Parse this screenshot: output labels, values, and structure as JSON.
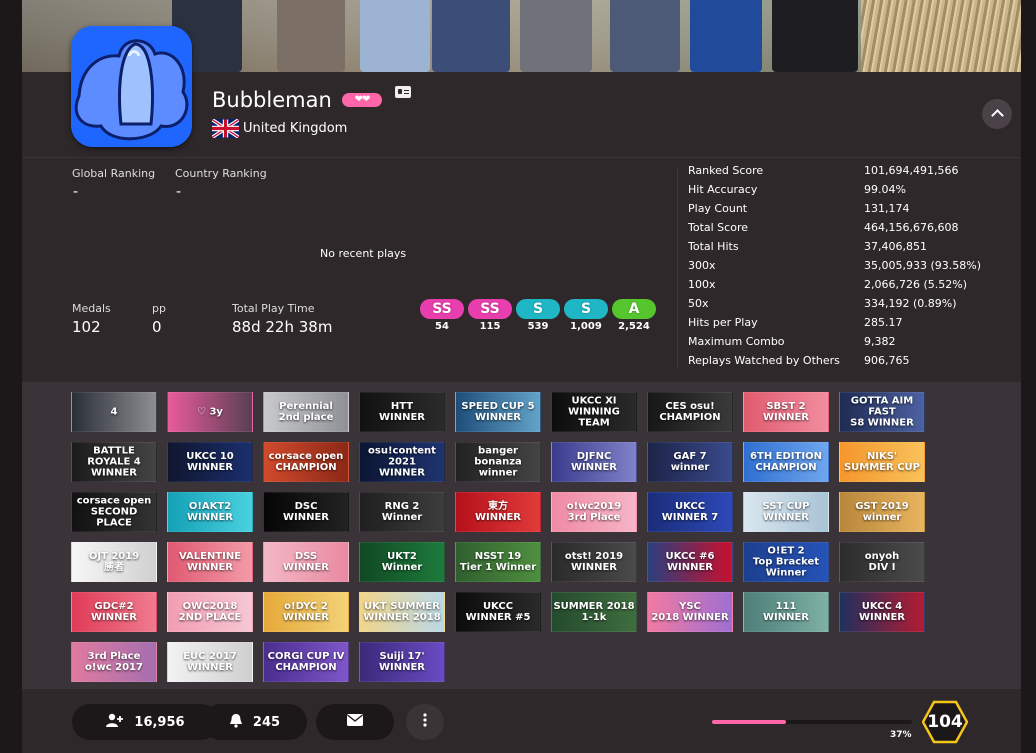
{
  "profile": {
    "username": "Bubbleman",
    "supporter_hearts": "❤❤",
    "country": "United Kingdom"
  },
  "ranking": {
    "global_label": "Global Ranking",
    "global_value": "-",
    "country_label": "Country Ranking",
    "country_value": "-"
  },
  "recent": {
    "empty_text": "No recent plays"
  },
  "summary": {
    "medals_label": "Medals",
    "medals_value": "102",
    "pp_label": "pp",
    "pp_value": "0",
    "playtime_label": "Total Play Time",
    "playtime_value": "88d 22h 38m"
  },
  "grades": [
    {
      "grade": "SS",
      "count": "54",
      "color": "#e93fae"
    },
    {
      "grade": "SS",
      "count": "115",
      "color": "#e93fae"
    },
    {
      "grade": "S",
      "count": "539",
      "color": "#1fb6c6"
    },
    {
      "grade": "S",
      "count": "1,009",
      "color": "#1fb6c6"
    },
    {
      "grade": "A",
      "count": "2,524",
      "color": "#55c62e"
    }
  ],
  "stats": [
    {
      "label": "Ranked Score",
      "value": "101,694,491,566"
    },
    {
      "label": "Hit Accuracy",
      "value": "99.04%"
    },
    {
      "label": "Play Count",
      "value": "131,174"
    },
    {
      "label": "Total Score",
      "value": "464,156,676,608"
    },
    {
      "label": "Total Hits",
      "value": "37,406,851"
    },
    {
      "label": "300x",
      "value": "35,005,933 (93.58%)"
    },
    {
      "label": "100x",
      "value": "2,066,726 (5.52%)"
    },
    {
      "label": "50x",
      "value": "334,192 (0.89%)"
    },
    {
      "label": "Hits per Play",
      "value": "285.17"
    },
    {
      "label": "Maximum Combo",
      "value": "9,382"
    },
    {
      "label": "Replays Watched by Others",
      "value": "906,765"
    }
  ],
  "badges": [
    {
      "text": "4",
      "bg": "linear-gradient(90deg,#2a2f37,#8d8e93)"
    },
    {
      "text": "♡  3y",
      "bg": "linear-gradient(90deg,#e85b9c,#5a3f53)"
    },
    {
      "text": "Perennial\n2nd place",
      "bg": "linear-gradient(90deg,#c8c9cc,#8f9196)"
    },
    {
      "text": "HTT\nWINNER",
      "bg": "linear-gradient(90deg,#111,#2b2b2b)"
    },
    {
      "text": "SPEED CUP 5\nWINNER",
      "bg": "linear-gradient(90deg,#1d4e7a,#63a3c9)"
    },
    {
      "text": "UKCC XI\nWINNING TEAM",
      "bg": "linear-gradient(90deg,#0d0d0d,#2a2a2a)"
    },
    {
      "text": "CES osu!\nCHAMPION",
      "bg": "linear-gradient(90deg,#171717,#3a3a3a)"
    },
    {
      "text": "SBST 2\nWINNER",
      "bg": "linear-gradient(90deg,#e05b6f,#f28ca0)"
    },
    {
      "text": "GOTTA AIM FAST\nS8 WINNER",
      "bg": "linear-gradient(90deg,#1e2b52,#4d62a3)"
    },
    {
      "text": "BATTLE ROYALE 4\nWINNER",
      "bg": "linear-gradient(90deg,#1b1b1b,#444)"
    },
    {
      "text": "UKCC 10\nWINNER",
      "bg": "linear-gradient(90deg,#10162f,#1b2f6e)"
    },
    {
      "text": "corsace open\nCHAMPION",
      "bg": "linear-gradient(90deg,#d14a2c,#8c2817)"
    },
    {
      "text": "osu!content 2021\nWINNER",
      "bg": "linear-gradient(90deg,#0b1533,#1f3470)"
    },
    {
      "text": "banger\nbonanza winner",
      "bg": "linear-gradient(90deg,#222,#444)"
    },
    {
      "text": "DJFNC\nWINNER",
      "bg": "linear-gradient(90deg,#3b3c8e,#7f82c8)"
    },
    {
      "text": "GAF 7\nwinner",
      "bg": "linear-gradient(90deg,#1c2448,#3a4a8c)"
    },
    {
      "text": "6TH EDITION\nCHAMPION",
      "bg": "linear-gradient(90deg,#2f6fd1,#6fa6ee)"
    },
    {
      "text": "NIKS'\nSUMMER CUP",
      "bg": "linear-gradient(90deg,#f5962c,#f8c25a)"
    },
    {
      "text": "corsace open\nSECOND PLACE",
      "bg": "linear-gradient(90deg,#111,#333)"
    },
    {
      "text": "O!AKT2\nWINNER",
      "bg": "linear-gradient(90deg,#14a1b6,#49d1e0)"
    },
    {
      "text": "DSC\nWINNER",
      "bg": "linear-gradient(90deg,#050505,#222)"
    },
    {
      "text": "RNG 2\nWinner",
      "bg": "linear-gradient(90deg,#1f1f1f,#3d3d3d)"
    },
    {
      "text": "東方\nWINNER",
      "bg": "linear-gradient(90deg,#b5111b,#e13a3a)"
    },
    {
      "text": "o!wc2019\n3rd Place",
      "bg": "linear-gradient(90deg,#f08aa6,#f6b5c6)"
    },
    {
      "text": "UKCC\nWINNER 7",
      "bg": "linear-gradient(90deg,#1a2d7a,#2d49b8)"
    },
    {
      "text": "SST CUP\nWINNER",
      "bg": "linear-gradient(90deg,#d9e6ee,#a9c4d6)"
    },
    {
      "text": "GST 2019\nwinner",
      "bg": "linear-gradient(90deg,#b9873b,#e8b45e)"
    },
    {
      "text": "OJT 2019\n勝者",
      "bg": "linear-gradient(90deg,#f7f7f7,#d0d0d0)"
    },
    {
      "text": "VALENTINE\nWINNER",
      "bg": "linear-gradient(90deg,#e05a71,#f39aa8)"
    },
    {
      "text": "DSS\nWINNER",
      "bg": "linear-gradient(90deg,#f3b7c5,#e98aa2)"
    },
    {
      "text": "UKT2\nWinner",
      "bg": "linear-gradient(90deg,#0f4a23,#1e7a3c)"
    },
    {
      "text": "NSST 19\nTier 1 Winner",
      "bg": "linear-gradient(90deg,#2f5f2f,#4f8f3f)"
    },
    {
      "text": "otst! 2019\nWINNER",
      "bg": "linear-gradient(90deg,#2a2a2a,#4a4a4a)"
    },
    {
      "text": "UKCC #6\nWINNER",
      "bg": "linear-gradient(90deg,#2b3f7d,#c8102e)"
    },
    {
      "text": "O!ET 2\nTop Bracket Winner",
      "bg": "linear-gradient(90deg,#1d3f8f,#2653b8)"
    },
    {
      "text": "onyoh\nDIV I",
      "bg": "linear-gradient(90deg,#2c2c2c,#4b4b4b)"
    },
    {
      "text": "GDC#2\nWINNER",
      "bg": "linear-gradient(90deg,#e03c57,#f07b8e)"
    },
    {
      "text": "OWC2018\n2ND PLACE",
      "bg": "linear-gradient(90deg,#f19db2,#f7c7d3)"
    },
    {
      "text": "o!DYC 2\nWINNER",
      "bg": "linear-gradient(90deg,#e6a93a,#f2d278)"
    },
    {
      "text": "UKT SUMMER\nWINNER 2018",
      "bg": "linear-gradient(90deg,#f1d58a,#b9d8e8)"
    },
    {
      "text": "UKCC\nWINNER #5",
      "bg": "linear-gradient(90deg,#0c0c0c,#2a2a2a)"
    },
    {
      "text": "SUMMER 2018\n1-1k",
      "bg": "linear-gradient(90deg,#244b2d,#3f6d3f)"
    },
    {
      "text": "YSC\n2018 WINNER",
      "bg": "linear-gradient(90deg,#f27aa2,#9e6fd2)"
    },
    {
      "text": "111\nWINNER",
      "bg": "linear-gradient(90deg,#4e7f78,#7fb0a6)"
    },
    {
      "text": "UKCC 4\nWINNER",
      "bg": "linear-gradient(90deg,#20305f,#b31c33)"
    },
    {
      "text": "3rd Place\no!wc 2017",
      "bg": "linear-gradient(90deg,#e07aa0,#a56fae)"
    },
    {
      "text": "EUC 2017\nWINNER",
      "bg": "linear-gradient(90deg,#f2f2f2,#cfcfcf)"
    },
    {
      "text": "CORGI CUP IV\nCHAMPION",
      "bg": "linear-gradient(90deg,#4b2e8f,#7e56c9)"
    },
    {
      "text": "Suiji 17'\nWINNER",
      "bg": "linear-gradient(90deg,#3b2a7a,#6a4bc4)"
    }
  ],
  "footer": {
    "followers": "16,956",
    "mapping_subs": "245",
    "progress_percent": 37,
    "progress_label": "37%",
    "level": "104"
  },
  "colors": {
    "accent": "#ff66aa",
    "background": "#2e282b",
    "badge_area": "#3a3337"
  }
}
